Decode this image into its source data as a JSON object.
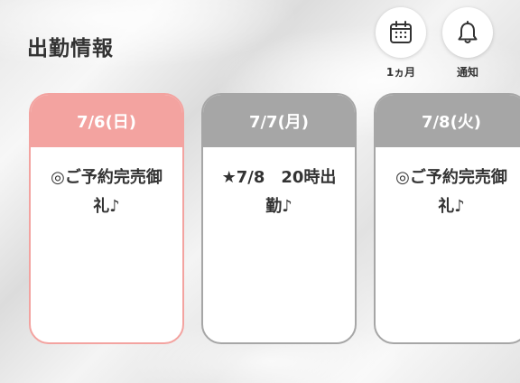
{
  "header": {
    "title": "出勤情報",
    "calendar_label": "1ヵ月",
    "notify_label": "通知"
  },
  "icons": {
    "calendar": "calendar-icon",
    "notify": "bell-icon"
  },
  "colors": {
    "today_accent": "#f3a3a0",
    "other_accent": "#a6a6a6"
  },
  "schedule": [
    {
      "date": "7/6(日)",
      "note_line1": "◎ご予約完売御",
      "note_line2": "礼♪"
    },
    {
      "date": "7/7(月)",
      "note_line1": "★7/8　20時出",
      "note_line2": "勤♪"
    },
    {
      "date": "7/8(火)",
      "note_line1": "◎ご予約完売御",
      "note_line2": "礼♪"
    }
  ]
}
